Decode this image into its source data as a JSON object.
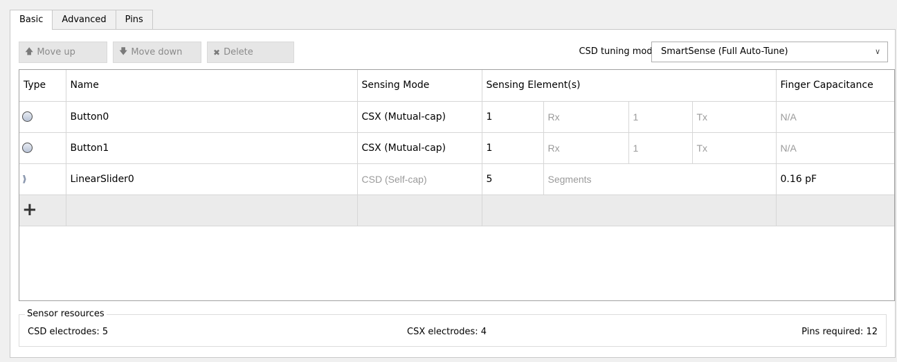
{
  "tabs": [
    "Basic",
    "Advanced",
    "Pins"
  ],
  "toolbar": {
    "move_up": "Move up",
    "move_down": "Move down",
    "delete": "Delete"
  },
  "tuning": {
    "label": "CSD tuning mode:",
    "value": "SmartSense (Full Auto-Tune)"
  },
  "table": {
    "headers": {
      "type": "Type",
      "name": "Name",
      "mode": "Sensing Mode",
      "elements": "Sensing Element(s)",
      "finger": "Finger Capacitance"
    },
    "rows": [
      {
        "type_icon": "button-widget-icon",
        "name": "Button0",
        "mode": "CSX (Mutual-cap)",
        "rx_count": "1",
        "rx_label": "Rx",
        "tx_count": "1",
        "tx_label": "Tx",
        "finger": "N/A"
      },
      {
        "type_icon": "button-widget-icon",
        "name": "Button1",
        "mode": "CSX (Mutual-cap)",
        "rx_count": "1",
        "rx_label": "Rx",
        "tx_count": "1",
        "tx_label": "Tx",
        "finger": "N/A"
      },
      {
        "type_icon": "linear-slider-icon",
        "name": "LinearSlider0",
        "mode": "CSD (Self-cap)",
        "count": "5",
        "unit": "Segments",
        "finger": "0.16 pF"
      }
    ]
  },
  "resources": {
    "title": "Sensor resources",
    "csd": "CSD electrodes:  5",
    "csx": "CSX electrodes:  4",
    "pins": "Pins required:  12"
  }
}
